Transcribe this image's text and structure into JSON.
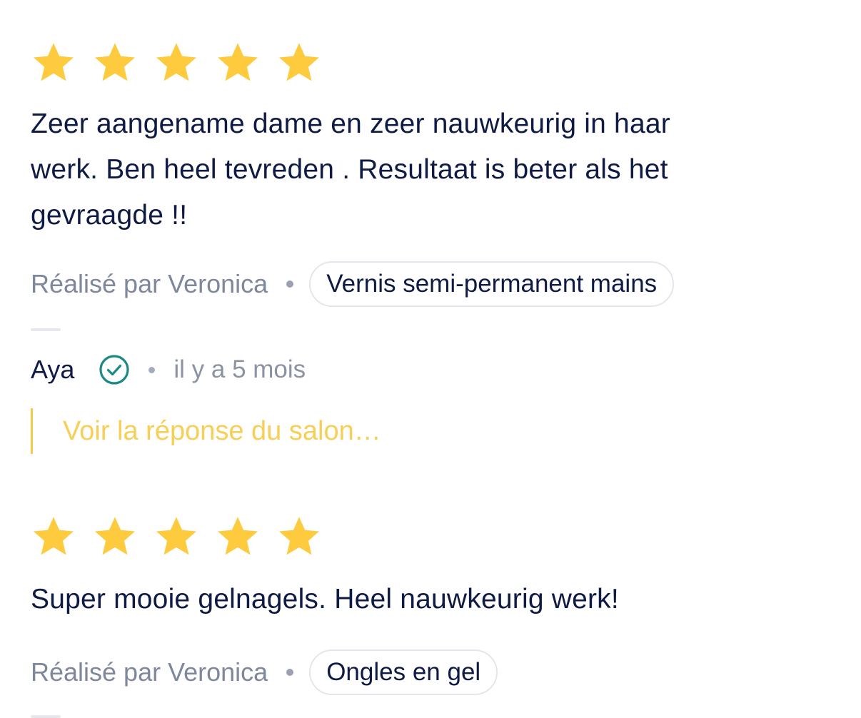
{
  "colors": {
    "star": "#fecb3f",
    "text": "#0f1a45",
    "muted": "#7f879c",
    "verified": "#1b8a87",
    "reply": "#f7cf57"
  },
  "reviews": [
    {
      "rating": 5,
      "rating_max": 5,
      "text": "Zeer aangename dame en zeer nauwkeurig in haar werk. Ben heel tevreden . Resultaat is beter als het gevraagde !!",
      "performer": "Réalisé par Veronica",
      "service": "Vernis semi-permanent mains",
      "author": "Aya",
      "verified_icon": "check-circle-icon",
      "date": "il y a 5 mois",
      "reply_link": "Voir la réponse du salon…"
    },
    {
      "rating": 5,
      "rating_max": 5,
      "text": "Super mooie gelnagels. Heel nauwkeurig werk!",
      "performer": "Réalisé par Veronica",
      "service": "Ongles en gel"
    }
  ]
}
